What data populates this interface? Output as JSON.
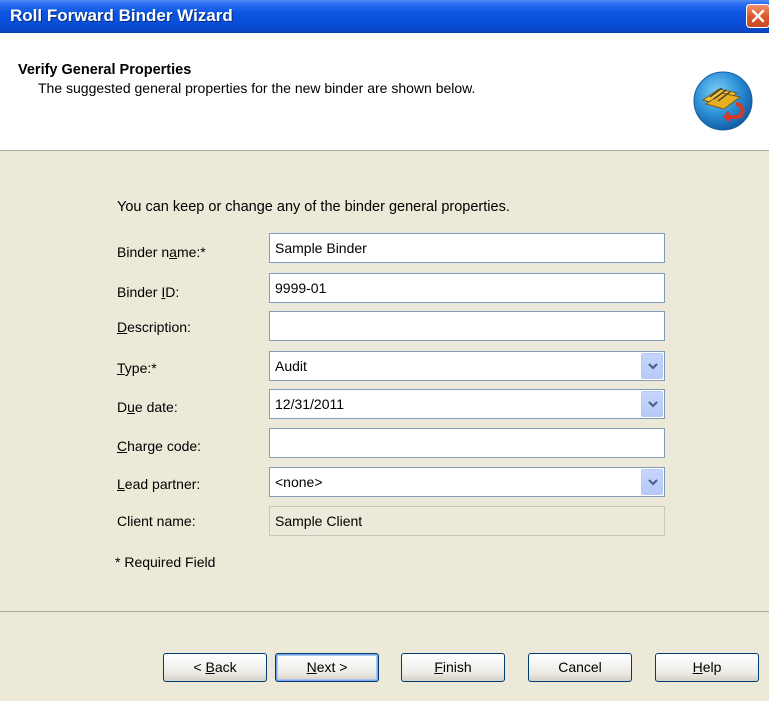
{
  "window": {
    "title": "Roll Forward Binder Wizard"
  },
  "header": {
    "title": "Verify General Properties",
    "subtitle": "The suggested general properties for the new binder are shown below."
  },
  "intro": "You can keep or change any of the binder general properties.",
  "fields": {
    "binder_name": {
      "label_pre": "Binder n",
      "label_u": "a",
      "label_post": "me:*",
      "value": "Sample Binder"
    },
    "binder_id": {
      "label_pre": "Binder ",
      "label_u": "I",
      "label_post": "D:",
      "value": "9999-01"
    },
    "description": {
      "label_pre": "",
      "label_u": "D",
      "label_post": "escription:",
      "value": ""
    },
    "type": {
      "label_pre": "",
      "label_u": "T",
      "label_post": "ype:*",
      "value": "Audit"
    },
    "due_date": {
      "label_pre": "D",
      "label_u": "u",
      "label_post": "e date:",
      "value": "12/31/2011"
    },
    "charge_code": {
      "label_pre": "",
      "label_u": "C",
      "label_post": "harge code:",
      "value": ""
    },
    "lead_partner": {
      "label_pre": "",
      "label_u": "L",
      "label_post": "ead partner:",
      "value": "<none>"
    },
    "client_name": {
      "label": "Client name:",
      "value": "Sample Client"
    }
  },
  "required_note": "* Required Field",
  "buttons": {
    "back": {
      "pre": "< ",
      "u": "B",
      "post": "ack"
    },
    "next": {
      "pre": "",
      "u": "N",
      "post": "ext >"
    },
    "finish": {
      "pre": "",
      "u": "F",
      "post": "inish"
    },
    "cancel": {
      "label": "Cancel"
    },
    "help": {
      "pre": "",
      "u": "H",
      "post": "elp"
    }
  },
  "icons": {
    "close": "close-icon",
    "wizard": "binder-wizard-icon",
    "dropdown": "chevron-down-icon"
  },
  "colors": {
    "titlebar": "#0a4fd8",
    "dialog_bg": "#ece9d8",
    "field_border": "#7f9db9"
  }
}
